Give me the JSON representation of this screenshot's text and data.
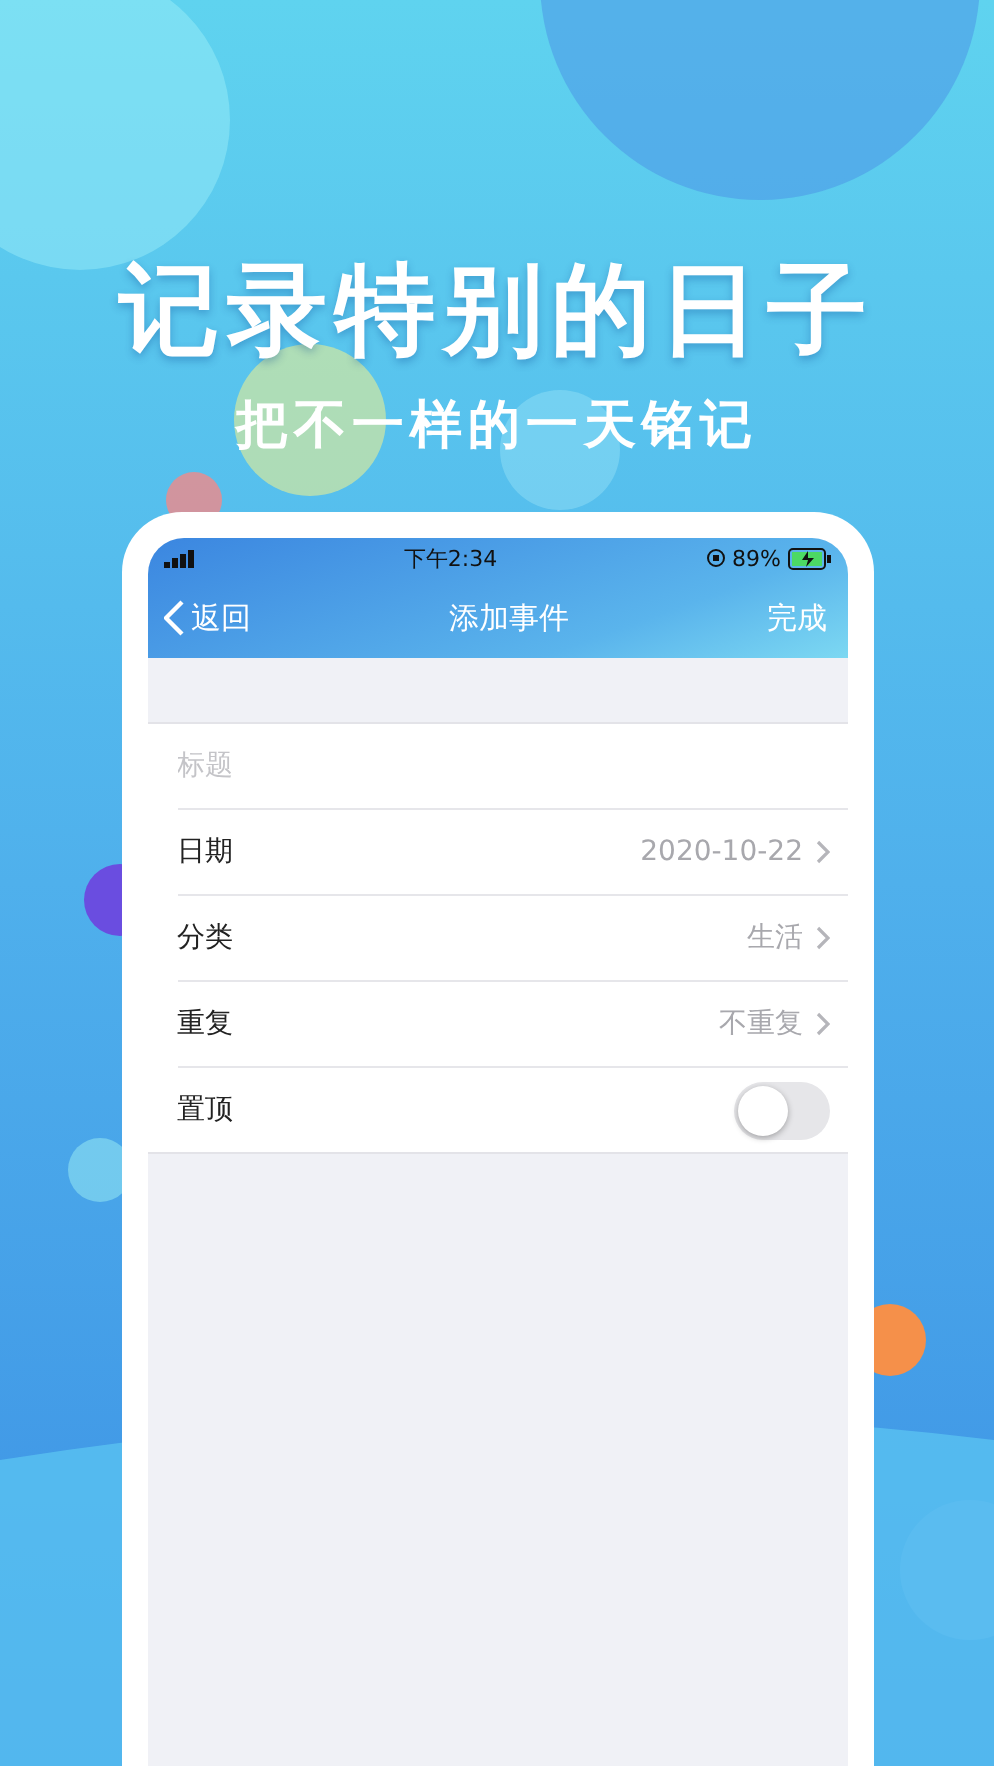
{
  "headline": "记录特别的日子",
  "subheadline": "把不一样的一天铭记",
  "status_bar": {
    "time": "下午2:34",
    "battery": "89%"
  },
  "nav": {
    "back": "返回",
    "title": "添加事件",
    "action": "完成"
  },
  "form": [
    {
      "kind": "input",
      "placeholder": "标题"
    },
    {
      "kind": "link",
      "label": "日期",
      "value": "2020-10-22"
    },
    {
      "kind": "link",
      "label": "分类",
      "value": "生活"
    },
    {
      "kind": "link",
      "label": "重复",
      "value": "不重复"
    },
    {
      "kind": "toggle",
      "label": "置顶",
      "on": false
    }
  ]
}
